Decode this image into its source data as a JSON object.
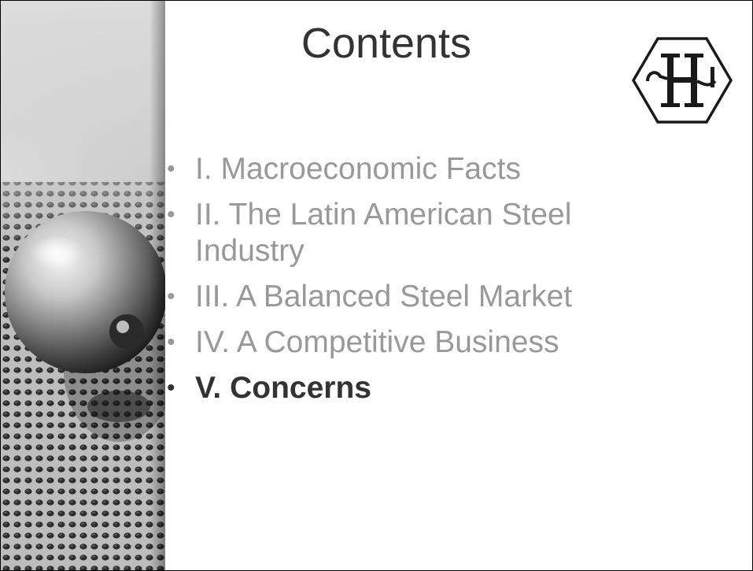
{
  "slide": {
    "title": "Contents",
    "logo_icon": "company-monogram-hexagon-logo",
    "side_image_icon": "chrome-sphere-on-perforated-metal-image",
    "items": [
      {
        "label": "I. Macroeconomic Facts",
        "active": false
      },
      {
        "label": "II. The Latin American Steel Industry",
        "active": false
      },
      {
        "label": "III. A Balanced Steel Market",
        "active": false
      },
      {
        "label": "IV. A Competitive Business",
        "active": false
      },
      {
        "label": "V. Concerns",
        "active": true
      }
    ],
    "bullet_char": "•"
  },
  "colors": {
    "inactive_text": "#999999",
    "active_text": "#333333",
    "title_text": "#333333"
  }
}
